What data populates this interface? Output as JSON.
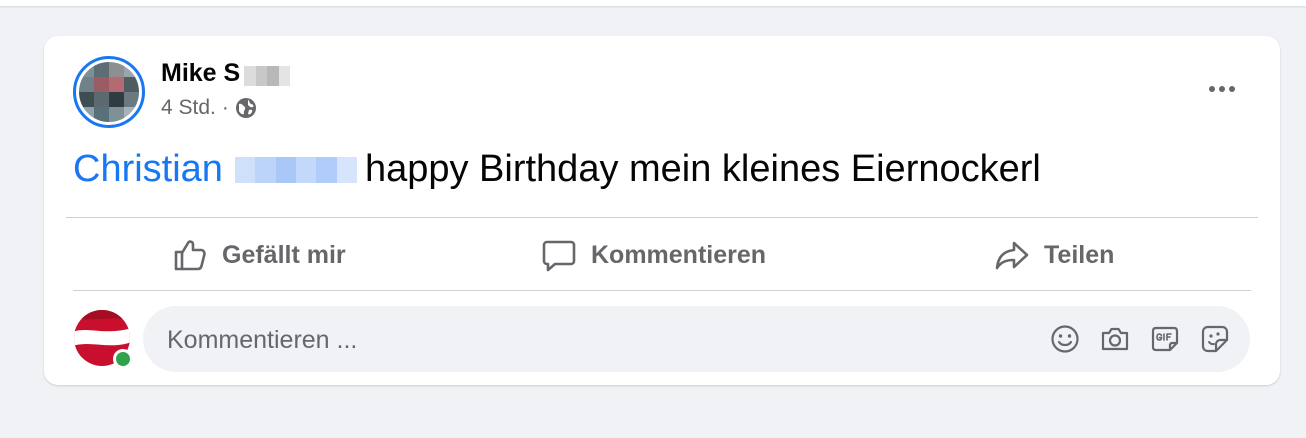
{
  "post": {
    "author_name": "Mike S",
    "time": "4 Std.",
    "separator": "·",
    "audience_icon": "globe-icon",
    "mention": "Christian",
    "text": "happy Birthday mein kleines Eiernockerl",
    "more_icon": "more-horizontal-icon"
  },
  "actions": {
    "like_label": "Gefällt mir",
    "comment_label": "Kommentieren",
    "share_label": "Teilen"
  },
  "comment": {
    "placeholder": "Kommentieren ...",
    "icons": [
      "emoji-icon",
      "camera-icon",
      "gif-icon",
      "sticker-icon"
    ]
  },
  "colors": {
    "link": "#1877f2",
    "muted": "#65676b",
    "online": "#31a24c",
    "page_bg": "#f0f2f5"
  }
}
